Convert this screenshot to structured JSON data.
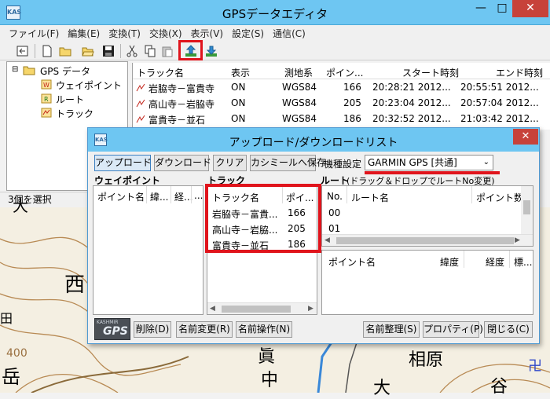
{
  "app": {
    "title": "GPSデータエディタ",
    "icon_text": "KAS"
  },
  "menu": [
    "ファイル(F)",
    "編集(E)",
    "変換(T)",
    "交換(X)",
    "表示(V)",
    "設定(S)",
    "通信(C)"
  ],
  "toolbar_icons": [
    "back-icon",
    "new-file-icon",
    "new-folder-icon",
    "open-folder-icon",
    "save-icon",
    "cut-icon",
    "copy-icon",
    "paste-icon",
    "upload-icon",
    "download-icon"
  ],
  "tree": {
    "root": "GPS データ",
    "children": [
      "ウェイポイント",
      "ルート",
      "トラック"
    ]
  },
  "status": "3個を選択",
  "track_table": {
    "headers": [
      "トラック名",
      "表示",
      "測地系",
      "ポイン...",
      "スタート時刻",
      "エンド時刻"
    ],
    "rows": [
      [
        "岩脇寺－富貴寺",
        "ON",
        "WGS84",
        "166",
        "20:28:21 2012...",
        "20:55:51 2012..."
      ],
      [
        "高山寺－岩脇寺",
        "ON",
        "WGS84",
        "205",
        "20:23:04 2012...",
        "20:57:04 2012..."
      ],
      [
        "富貴寺－並石",
        "ON",
        "WGS84",
        "186",
        "20:32:52 2012...",
        "21:03:42 2012..."
      ]
    ]
  },
  "map_labels": [
    "西",
    "大",
    "田",
    "400",
    "岳",
    "眞",
    "中",
    "相原",
    "卍",
    "谷",
    "大"
  ],
  "dialog": {
    "title": "アップロード/ダウンロードリスト",
    "buttons": {
      "upload": "アップロード",
      "download": "ダウンロード",
      "clear": "クリア",
      "save_kashmir": "カシミールへ保存",
      "delete": "削除(D)",
      "rename": "名前変更(R)",
      "name_op": "名前操作(N)",
      "name_sort": "名前整理(S)",
      "properties": "プロパティ(P)",
      "close": "閉じる(C)"
    },
    "model_label": "機種設定",
    "model_value": "GARMIN GPS [共通]",
    "sections": {
      "waypoint": "ウェイポイント",
      "track": "トラック",
      "route": "ルート",
      "route_hint": "(ドラッグ＆ドロップでルートNo変更)"
    },
    "waypoint_columns": [
      "ポイント名",
      "緯...",
      "経...",
      "..."
    ],
    "track_columns": [
      "トラック名",
      "ポイ..."
    ],
    "track_rows": [
      [
        "岩脇寺－富貴...",
        "166"
      ],
      [
        "高山寺－岩脇...",
        "205"
      ],
      [
        "富貴寺－並石",
        "186"
      ]
    ],
    "route_columns": [
      "No.",
      "ルート名",
      "ポイント数"
    ],
    "route_rows": [
      "00",
      "01"
    ],
    "point_columns": [
      "ポイント名",
      "緯度",
      "経度",
      "標..."
    ],
    "logo_text": "GPS",
    "logo_caption": "KASHMIR"
  },
  "colors": {
    "titlebar": "#6ec6f2",
    "highlight": "#e0141c",
    "close": "#c7423a"
  }
}
